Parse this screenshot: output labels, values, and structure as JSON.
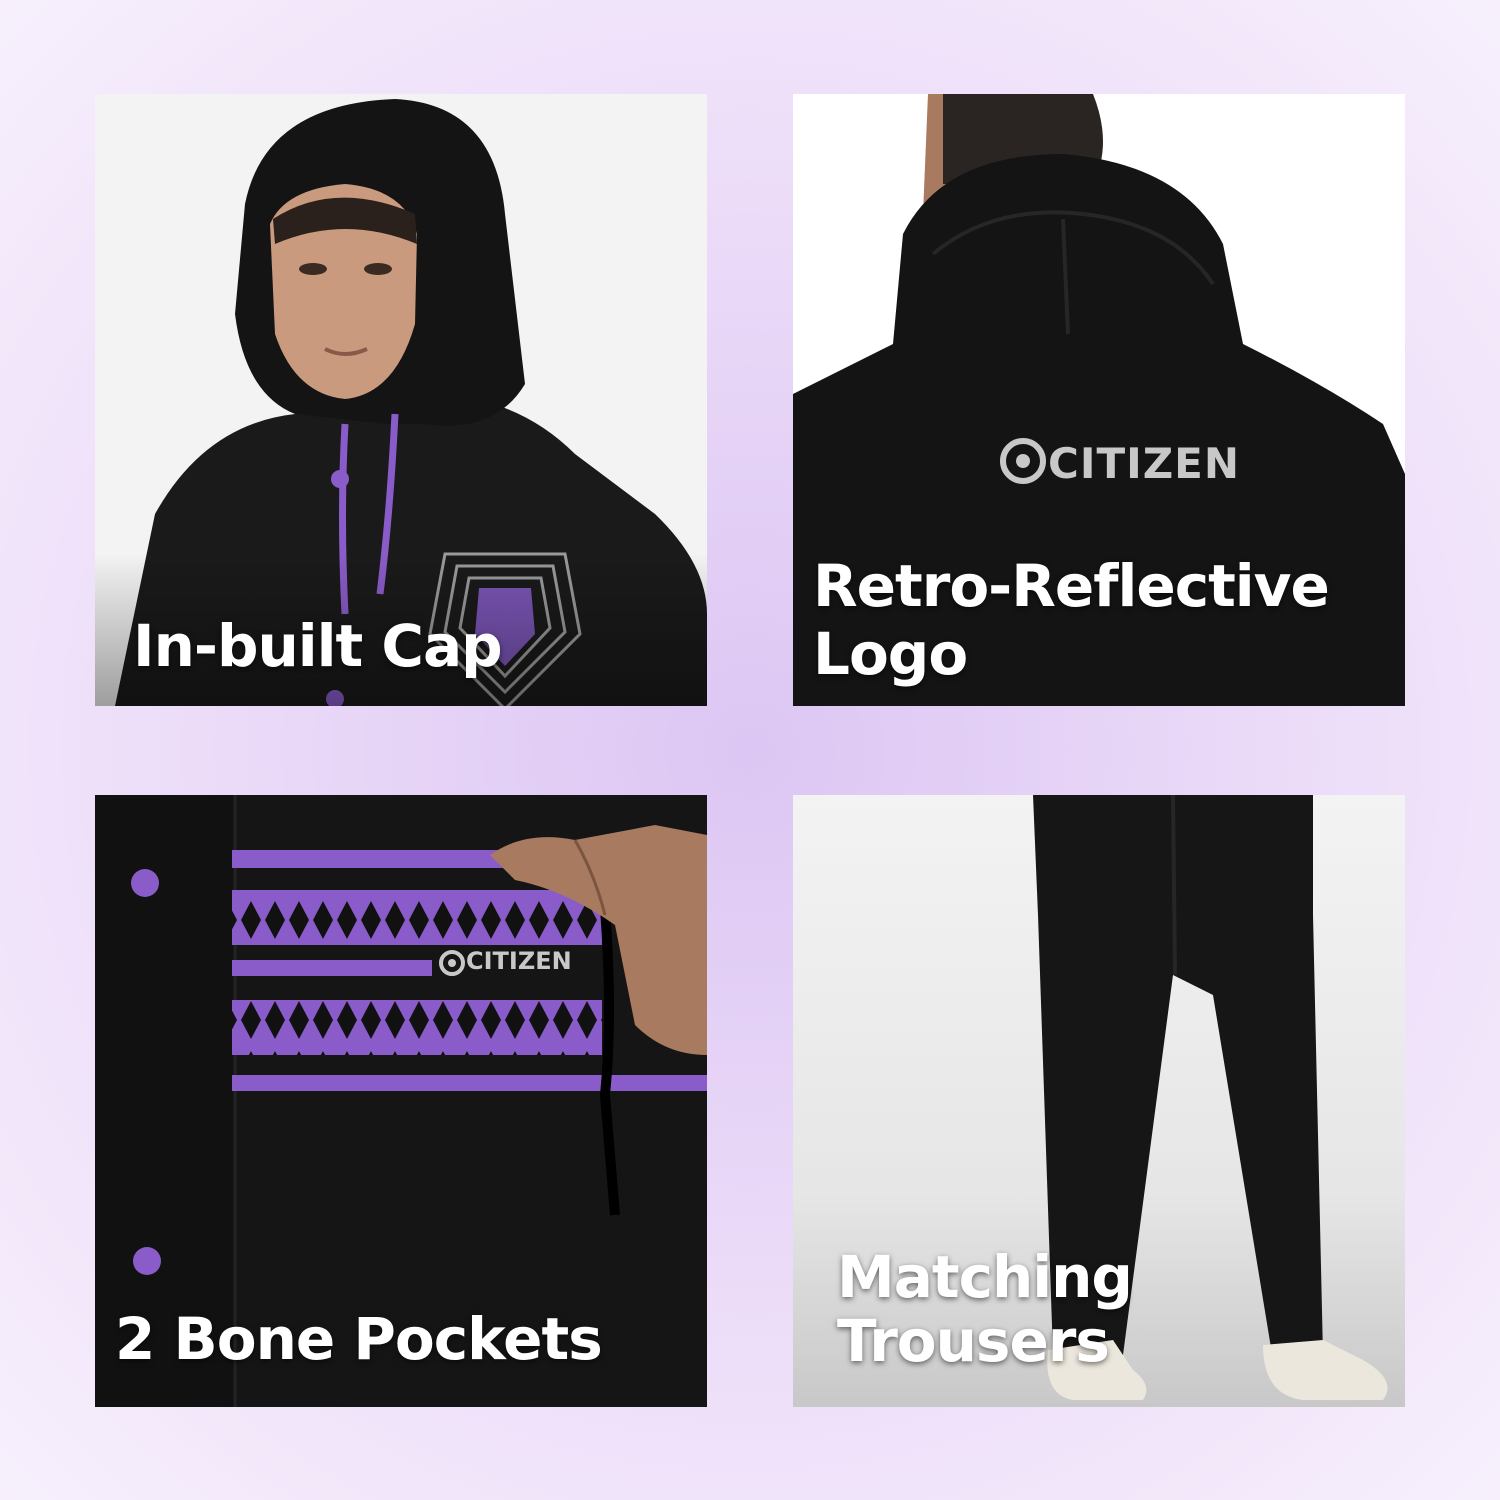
{
  "panels": [
    {
      "id": "p1",
      "caption_lines": [
        "In-built Cap"
      ]
    },
    {
      "id": "p2",
      "caption_lines": [
        "Retro-Reflective",
        "Logo"
      ],
      "brand_logo_text": "CITIZEN"
    },
    {
      "id": "p3",
      "caption_lines": [
        "2 Bone Pockets"
      ],
      "brand_logo_text": "CITIZEN"
    },
    {
      "id": "p4",
      "caption_lines": [
        "Matching",
        "Trousers"
      ]
    }
  ],
  "colors": {
    "accent_purple": "#8a5cc9",
    "jacket_black": "#161616",
    "background_lavender": "#e3cff6"
  }
}
